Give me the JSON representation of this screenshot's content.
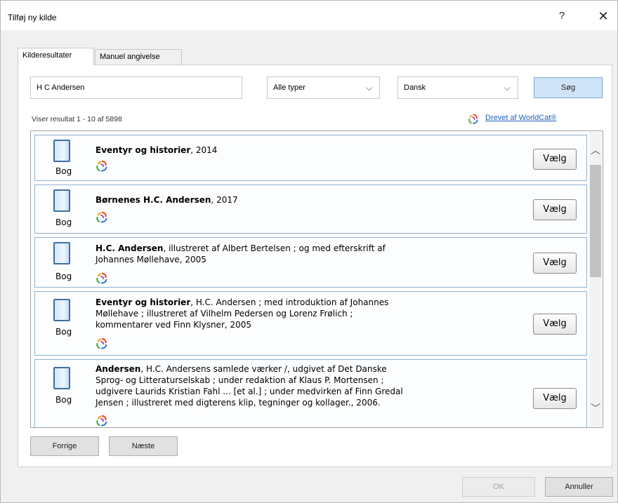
{
  "window": {
    "title": "Tilføj ny kilde",
    "help_label": "?",
    "close_label": "✕"
  },
  "tabs": [
    {
      "label": "Kilderesultater",
      "active": true
    },
    {
      "label": "Manuel angivelse",
      "active": false
    }
  ],
  "search": {
    "query": "H C Andersen",
    "type_filter": "Alle typer",
    "language_filter": "Dansk",
    "search_label": "Søg"
  },
  "results_header": {
    "count_text": "Viser resultat 1 - 10 af 5898",
    "powered_by": "Drevet af WorldCat®"
  },
  "results": [
    {
      "type_label": "Bog",
      "title": "Eventyr og historier",
      "rest_lines": [
        ", 2014"
      ],
      "choose_label": "Vælg"
    },
    {
      "type_label": "Bog",
      "title": "Børnenes H.C. Andersen",
      "rest_lines": [
        ", 2017"
      ],
      "choose_label": "Vælg"
    },
    {
      "type_label": "Bog",
      "title": "H.C. Andersen",
      "rest_lines": [
        ", illustreret af Albert Bertelsen ; og med efterskrift af",
        "Johannes Møllehave, 2005"
      ],
      "choose_label": "Vælg"
    },
    {
      "type_label": "Bog",
      "title": "Eventyr og historier",
      "rest_lines": [
        ", H.C. Andersen ; med introduktion af Johannes",
        "Møllehave ; illustreret af Vilhelm Pedersen og Lorenz Frølich ;",
        "kommentarer ved Finn Klysner, 2005"
      ],
      "choose_label": "Vælg"
    },
    {
      "type_label": "Bog",
      "title": "Andersen",
      "rest_lines": [
        ", H.C. Andersens samlede værker /, udgivet af Det Danske",
        "Sprog- og Litteraturselskab ; under redaktion af Klaus P. Mortensen ;",
        "udgivere Laurids Kristian Fahl ... [et al.] ; under medvirken af Finn Gredal",
        "Jensen ; illustreret med digterens klip, tegninger og kollager., 2006."
      ],
      "choose_label": "Vælg"
    }
  ],
  "pager": {
    "previous_label": "Forrige",
    "next_label": "Næste"
  },
  "footer": {
    "ok_label": "OK",
    "cancel_label": "Annuller"
  },
  "colors": {
    "accent": "#2060c0",
    "card_border": "#8eb2d3",
    "search_button": "#cfe3f7"
  }
}
